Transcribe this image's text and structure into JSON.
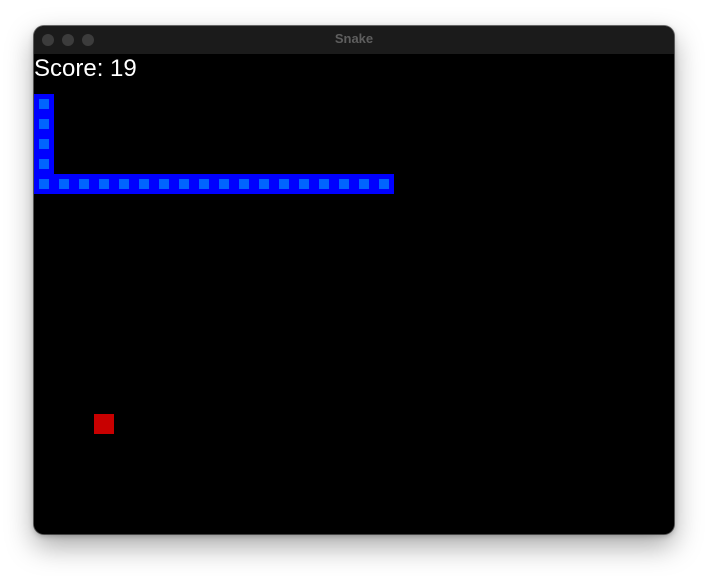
{
  "window": {
    "title": "Snake"
  },
  "game": {
    "score_text": "Score: 19",
    "score": 19,
    "grid_cell": "20px",
    "snake": [
      {
        "col": 0,
        "row": 2
      },
      {
        "col": 0,
        "row": 3
      },
      {
        "col": 0,
        "row": 4
      },
      {
        "col": 0,
        "row": 5
      },
      {
        "col": 0,
        "row": 6
      },
      {
        "col": 1,
        "row": 6
      },
      {
        "col": 2,
        "row": 6
      },
      {
        "col": 3,
        "row": 6
      },
      {
        "col": 4,
        "row": 6
      },
      {
        "col": 5,
        "row": 6
      },
      {
        "col": 6,
        "row": 6
      },
      {
        "col": 7,
        "row": 6
      },
      {
        "col": 8,
        "row": 6
      },
      {
        "col": 9,
        "row": 6
      },
      {
        "col": 10,
        "row": 6
      },
      {
        "col": 11,
        "row": 6
      },
      {
        "col": 12,
        "row": 6
      },
      {
        "col": 13,
        "row": 6
      },
      {
        "col": 14,
        "row": 6
      },
      {
        "col": 15,
        "row": 6
      },
      {
        "col": 16,
        "row": 6
      },
      {
        "col": 17,
        "row": 6
      }
    ],
    "food": {
      "col": 3,
      "row": 18
    }
  },
  "colors": {
    "background": "#000000",
    "snake_fill": "#0064ff",
    "snake_border": "#0000ff",
    "food": "#c80000",
    "score_text": "#ffffff"
  }
}
